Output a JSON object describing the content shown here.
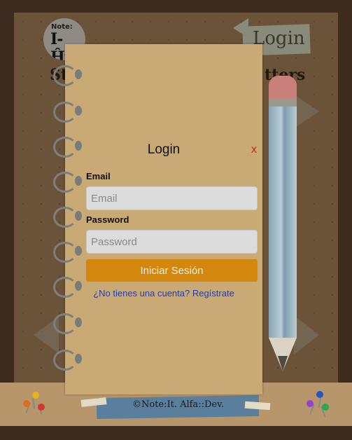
{
  "header": {
    "logo_top": "Note:",
    "logo_main": "I-Ĥit",
    "login_link": "Login",
    "heading_left": "Sto",
    "heading_right": "tters"
  },
  "modal": {
    "title": "Login",
    "close_label": "x",
    "email_label": "Email",
    "email_placeholder": "Email",
    "password_label": "Password",
    "password_placeholder": "Password",
    "submit_label": "Iniciar Sesión",
    "register_link": "¿No tienes una cuenta? Regístrate"
  },
  "footer": {
    "credit": "©Note:It. Alfa::Dev."
  },
  "colors": {
    "submit": "#d4870d",
    "close": "#c22121",
    "link": "#2a3ca8",
    "notebook": "#c9a974"
  }
}
